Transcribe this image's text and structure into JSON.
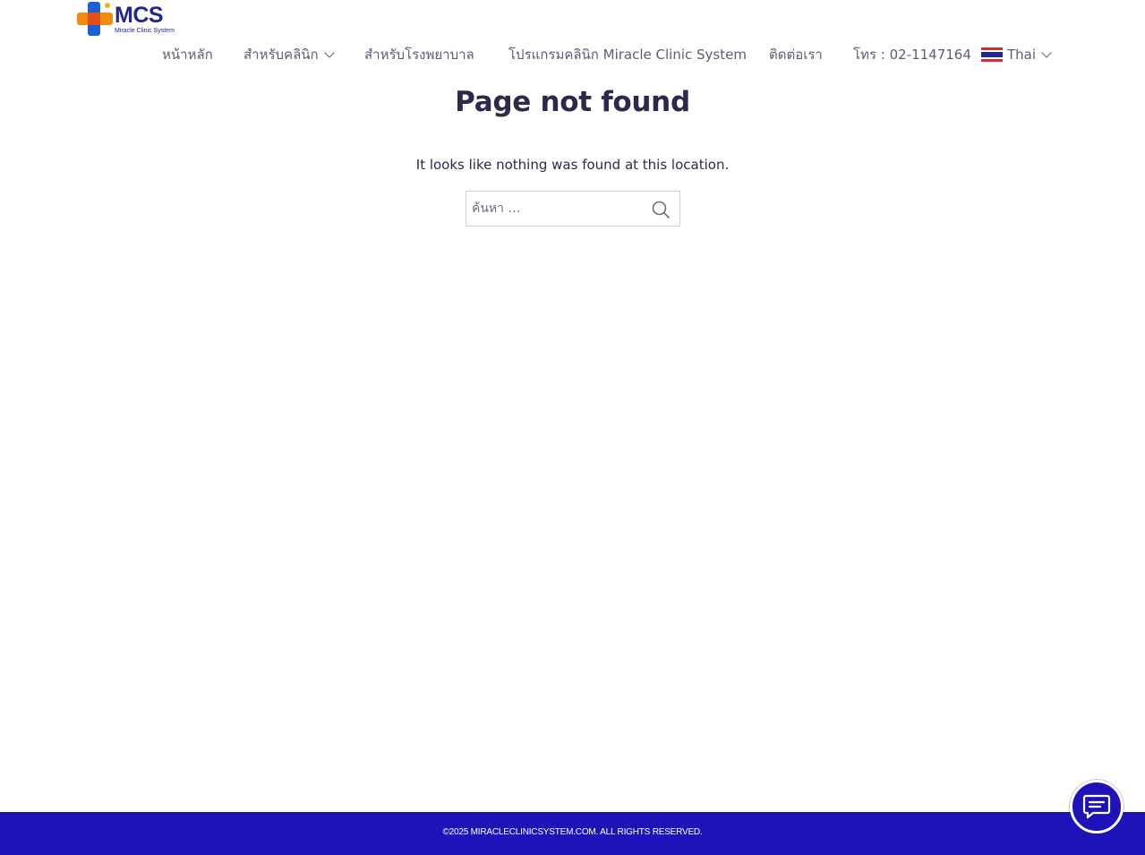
{
  "logo": {
    "brand": "MCS",
    "tagline": "Miracle Clinic System"
  },
  "nav": {
    "items": [
      {
        "label": "หน้าหลัก"
      },
      {
        "label": "สำหรับคลินิก"
      },
      {
        "label": "สำหรับโรงพยาบาล"
      },
      {
        "label": "โปรแกรมคลินิก Miracle Clinic System"
      },
      {
        "label": "ติดต่อเรา"
      },
      {
        "label": "โทร : 02-1147164"
      }
    ],
    "language": "Thai"
  },
  "main": {
    "title": "Page not found",
    "message": "It looks like nothing was found at this location.",
    "search_placeholder": "ค้นหา …"
  },
  "footer": {
    "copyright": "©2025 MIRACLECLINICSYSTEM.COM. ALL RIGHTS RESERVED."
  },
  "colors": {
    "brand": "#1e13b8",
    "heading": "#2b2a4c",
    "nav_text": "#5a5f75"
  },
  "icons": {
    "search": "search-icon",
    "chat": "chat-bubble-icon",
    "dropdown": "chevron-down-icon",
    "flag": "thailand-flag-icon"
  }
}
